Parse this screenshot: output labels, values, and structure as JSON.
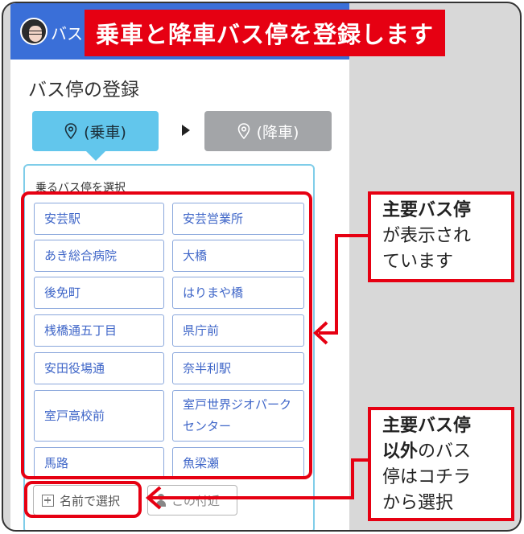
{
  "app": {
    "name": "バス"
  },
  "page": {
    "title": "バス停の登録"
  },
  "steps": {
    "boarding_label": "(乗車)",
    "alighting_label": "(降車)"
  },
  "panel": {
    "label": "乗るバス停を選択",
    "stops": [
      "安芸駅",
      "安芸営業所",
      "あき総合病院",
      "大橋",
      "後免町",
      "はりまや橋",
      "桟橋通五丁目",
      "県庁前",
      "安田役場通",
      "奈半利駅",
      "室戸高校前",
      "室戸世界ジオパークセンター",
      "馬路",
      "魚梁瀬"
    ]
  },
  "bottom": {
    "by_name": "名前で選択",
    "nearby": "この付近"
  },
  "annotations": {
    "banner": "乗車と降車バス停を登録します",
    "callout_main": {
      "bold": "主要バス停",
      "rest1": "が表示され",
      "rest2": "ています"
    },
    "callout_other": {
      "bold1": "主要バス停",
      "bold2": "以外",
      "rest1": "のバス",
      "rest2": "停はコチラ",
      "rest3": "から選択"
    }
  },
  "colors": {
    "header_blue": "#3a6fd8",
    "active_step": "#62c6ec",
    "inactive_step": "#a3a5a8",
    "stop_text": "#3f66c8",
    "annotation_red": "#e60012"
  },
  "icons": [
    "map-pin-icon",
    "plus-square-icon",
    "person-icon",
    "triangle-right-icon",
    "avatar"
  ]
}
